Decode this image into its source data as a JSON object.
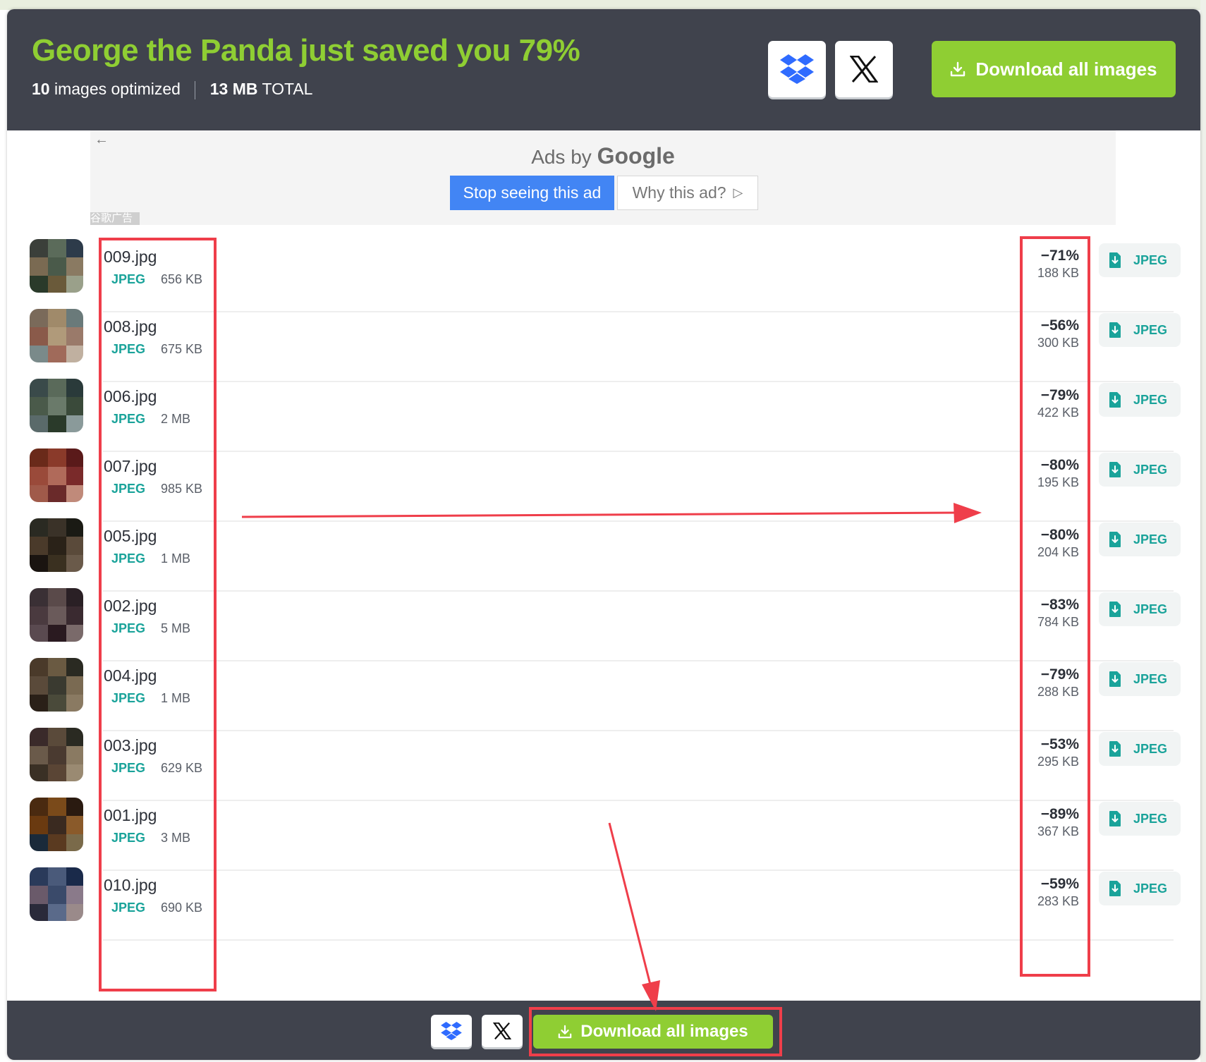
{
  "header": {
    "title": "George the Panda just saved you 79%",
    "images_count": "10",
    "images_label": "images optimized",
    "total_size": "13 MB",
    "total_label": "TOTAL",
    "download_all_label": "Download all images"
  },
  "ad": {
    "ads_by": "Ads by",
    "google": "Google",
    "stop_label": "Stop seeing this ad",
    "why_label": "Why this ad?",
    "cn_label": "谷歌广告"
  },
  "files": [
    {
      "name": "009.jpg",
      "type": "JPEG",
      "original_size": "656 KB",
      "saving": "−71%",
      "new_size": "188 KB",
      "download_label": "JPEG"
    },
    {
      "name": "008.jpg",
      "type": "JPEG",
      "original_size": "675 KB",
      "saving": "−56%",
      "new_size": "300 KB",
      "download_label": "JPEG"
    },
    {
      "name": "006.jpg",
      "type": "JPEG",
      "original_size": "2 MB",
      "saving": "−79%",
      "new_size": "422 KB",
      "download_label": "JPEG"
    },
    {
      "name": "007.jpg",
      "type": "JPEG",
      "original_size": "985 KB",
      "saving": "−80%",
      "new_size": "195 KB",
      "download_label": "JPEG"
    },
    {
      "name": "005.jpg",
      "type": "JPEG",
      "original_size": "1 MB",
      "saving": "−80%",
      "new_size": "204 KB",
      "download_label": "JPEG"
    },
    {
      "name": "002.jpg",
      "type": "JPEG",
      "original_size": "5 MB",
      "saving": "−83%",
      "new_size": "784 KB",
      "download_label": "JPEG"
    },
    {
      "name": "004.jpg",
      "type": "JPEG",
      "original_size": "1 MB",
      "saving": "−79%",
      "new_size": "288 KB",
      "download_label": "JPEG"
    },
    {
      "name": "003.jpg",
      "type": "JPEG",
      "original_size": "629 KB",
      "saving": "−53%",
      "new_size": "295 KB",
      "download_label": "JPEG"
    },
    {
      "name": "001.jpg",
      "type": "JPEG",
      "original_size": "3 MB",
      "saving": "−89%",
      "new_size": "367 KB",
      "download_label": "JPEG"
    },
    {
      "name": "010.jpg",
      "type": "JPEG",
      "original_size": "690 KB",
      "saving": "−59%",
      "new_size": "283 KB",
      "download_label": "JPEG"
    }
  ],
  "footer": {
    "download_all_label": "Download all images"
  },
  "colors": {
    "accent_green": "#8fce33",
    "header_bg": "#40434d",
    "teal": "#1aa39a",
    "annotation_red": "#ef3e4a"
  },
  "icons": [
    "dropbox-icon",
    "x-logo-icon",
    "download-icon",
    "file-download-icon",
    "back-arrow-icon",
    "play-outline-icon"
  ]
}
